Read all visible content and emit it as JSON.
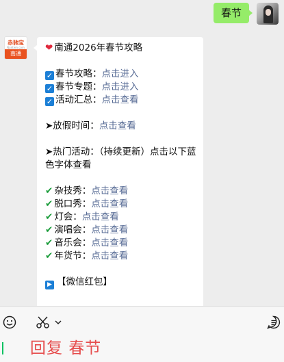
{
  "me": {
    "message": "春节"
  },
  "bot": {
    "avatar": {
      "top": "赤驰宝",
      "mid": "Nantem.com",
      "bottom": "南通"
    },
    "title": "南通2026年春节攻略",
    "checks": [
      {
        "label": "春节攻略：",
        "link": "点击进入"
      },
      {
        "label": "春节专题：",
        "link": "点击进入"
      },
      {
        "label": "活动汇总：",
        "link": "点击查看"
      }
    ],
    "holiday": {
      "label": "➤放假时间：",
      "link": "点击查看"
    },
    "hot": "➤热门活动：（持续更新）点击以下蓝色字体查看",
    "events": [
      {
        "label": "杂技秀：",
        "link": "点击查看"
      },
      {
        "label": "脱口秀：",
        "link": "点击查看"
      },
      {
        "label": "灯会：",
        "link": "点击查看"
      },
      {
        "label": "演唱会：",
        "link": "点击查看"
      },
      {
        "label": "音乐会：",
        "link": "点击查看"
      },
      {
        "label": "年货节：",
        "link": "点击查看"
      }
    ],
    "redpacket": "【微信红包】"
  },
  "composer": {
    "text": "回复 春节"
  },
  "icons": {
    "emoji": "emoji-icon",
    "scissors": "scissors-icon",
    "chevron": "chevron-down-icon",
    "menu": "menu-icon"
  }
}
